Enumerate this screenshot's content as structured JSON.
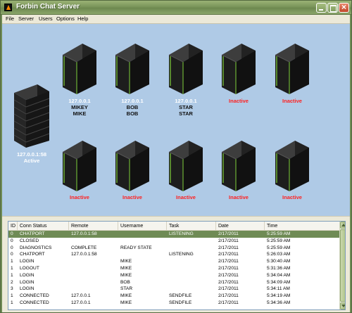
{
  "window": {
    "title": "Forbin Chat Server"
  },
  "menu": [
    "File",
    "Server",
    "Users",
    "Options",
    "Help"
  ],
  "colors": {
    "titlebar": "#7a955a",
    "canvas": "#afcae6",
    "inactive": "#ff2020",
    "selected_row": "#6f8b55",
    "server_led": "#7fd13b"
  },
  "main_server": {
    "address": "127.0.0.1:58",
    "status": "Active",
    "icon": "server-rack-icon"
  },
  "clients": [
    {
      "status": "127.0.0.1",
      "user": "MIKEY",
      "nick": "MIKE",
      "icon": "client-tower-icon"
    },
    {
      "status": "127.0.0.1",
      "user": "BOB",
      "nick": "BOB",
      "icon": "client-tower-icon"
    },
    {
      "status": "127.0.0.1",
      "user": "STAR",
      "nick": "STAR",
      "icon": "client-tower-icon"
    },
    {
      "status": "Inactive",
      "user": "",
      "nick": "",
      "icon": "client-tower-icon"
    },
    {
      "status": "Inactive",
      "user": "",
      "nick": "",
      "icon": "client-tower-icon"
    },
    {
      "status": "Inactive",
      "user": "",
      "nick": "",
      "icon": "client-tower-icon"
    },
    {
      "status": "Inactive",
      "user": "",
      "nick": "",
      "icon": "client-tower-icon"
    },
    {
      "status": "Inactive",
      "user": "",
      "nick": "",
      "icon": "client-tower-icon"
    },
    {
      "status": "Inactive",
      "user": "",
      "nick": "",
      "icon": "client-tower-icon"
    },
    {
      "status": "Inactive",
      "user": "",
      "nick": "",
      "icon": "client-tower-icon"
    }
  ],
  "log": {
    "columns": [
      "ID",
      "Conn Status",
      "Remote",
      "Username",
      "Task",
      "Date",
      "Time"
    ],
    "rows": [
      [
        "0",
        "CHATPORT",
        "127.0.0.1:58",
        "",
        "LISTENING",
        "2/17/2011",
        "5:25:59 AM"
      ],
      [
        "0",
        "CLOSED",
        "",
        "",
        "",
        "2/17/2011",
        "5:25:59 AM"
      ],
      [
        "0",
        "DIAGNOSTICS",
        "COMPLETE",
        "READY STATE",
        "",
        "2/17/2011",
        "5:25:59 AM"
      ],
      [
        "0",
        "CHATPORT",
        "127.0.0.1:58",
        "",
        "LISTENING",
        "2/17/2011",
        "5:26:03 AM"
      ],
      [
        "1",
        "LOGIN",
        "",
        "MIKE",
        "",
        "2/17/2011",
        "5:30:40 AM"
      ],
      [
        "1",
        "LOGOUT",
        "",
        "MIKE",
        "",
        "2/17/2011",
        "5:31:36 AM"
      ],
      [
        "1",
        "LOGIN",
        "",
        "MIKE",
        "",
        "2/17/2011",
        "5:34:04 AM"
      ],
      [
        "2",
        "LOGIN",
        "",
        "BOB",
        "",
        "2/17/2011",
        "5:34:09 AM"
      ],
      [
        "3",
        "LOGIN",
        "",
        "STAR",
        "",
        "2/17/2011",
        "5:34:11 AM"
      ],
      [
        "1",
        "CONNECTED",
        "127.0.0.1",
        "MIKE",
        "SENDFILE",
        "2/17/2011",
        "5:34:19 AM"
      ],
      [
        "1",
        "CONNECTED",
        "127.0.0.1",
        "MIKE",
        "SENDFILE",
        "2/17/2011",
        "5:34:36 AM"
      ]
    ],
    "selected_index": 0
  }
}
